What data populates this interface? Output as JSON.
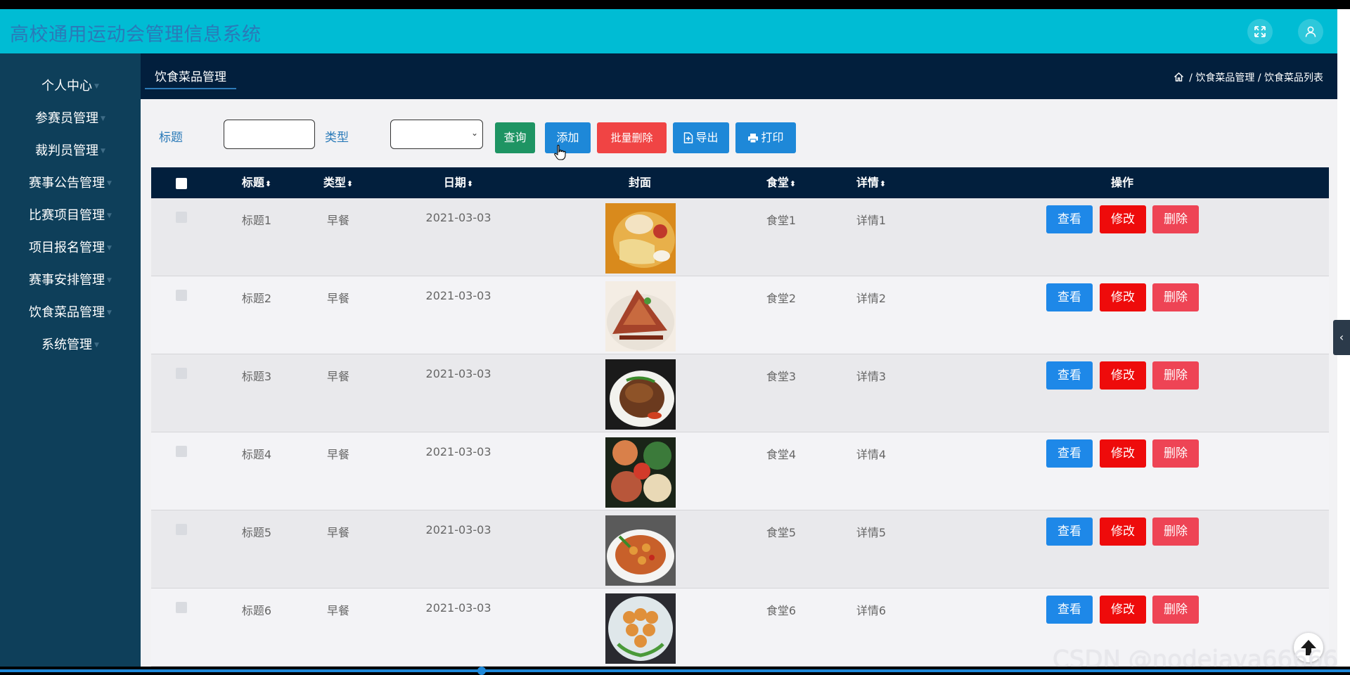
{
  "app": {
    "title": "高校通用运动会管理信息系统"
  },
  "sidebar": {
    "items": [
      {
        "label": "个人中心"
      },
      {
        "label": "参赛员管理"
      },
      {
        "label": "裁判员管理"
      },
      {
        "label": "赛事公告管理"
      },
      {
        "label": "比赛项目管理"
      },
      {
        "label": "项目报名管理"
      },
      {
        "label": "赛事安排管理"
      },
      {
        "label": "饮食菜品管理"
      },
      {
        "label": "系统管理"
      }
    ]
  },
  "page": {
    "tab": "饮食菜品管理",
    "breadcrumb": [
      "饮食菜品管理",
      "饮食菜品列表"
    ],
    "breadcrumb_sep": "/"
  },
  "search": {
    "title_label": "标题",
    "title_value": "",
    "type_label": "类型",
    "type_value": ""
  },
  "buttons": {
    "query": "查询",
    "add": "添加",
    "batch_delete": "批量删除",
    "export": "导出",
    "print": "打印"
  },
  "table": {
    "headers": {
      "title": "标题",
      "type": "类型",
      "date": "日期",
      "cover": "封面",
      "canteen": "食堂",
      "detail": "详情",
      "actions": "操作"
    },
    "action_labels": {
      "view": "查看",
      "edit": "修改",
      "delete": "删除"
    },
    "rows": [
      {
        "title": "标题1",
        "type": "早餐",
        "date": "2021-03-03",
        "canteen": "食堂1",
        "detail": "详情1"
      },
      {
        "title": "标题2",
        "type": "早餐",
        "date": "2021-03-03",
        "canteen": "食堂2",
        "detail": "详情2"
      },
      {
        "title": "标题3",
        "type": "早餐",
        "date": "2021-03-03",
        "canteen": "食堂3",
        "detail": "详情3"
      },
      {
        "title": "标题4",
        "type": "早餐",
        "date": "2021-03-03",
        "canteen": "食堂4",
        "detail": "详情4"
      },
      {
        "title": "标题5",
        "type": "早餐",
        "date": "2021-03-03",
        "canteen": "食堂5",
        "detail": "详情5"
      },
      {
        "title": "标题6",
        "type": "早餐",
        "date": "2021-03-03",
        "canteen": "食堂6",
        "detail": "详情6"
      }
    ]
  },
  "watermark": "CSDN @nodejava666666",
  "colors": {
    "topbar": "#00bcd4",
    "sidebar": "#0e3f5a",
    "header_dark": "#021f3d",
    "query_btn": "#1e9463",
    "blue_btn": "#1e88d8",
    "red_btn": "#f04444",
    "edit_btn": "#ee0b0b",
    "delete_btn": "#ee4455"
  },
  "icons": {
    "fullscreen": "expand-icon",
    "user": "user-icon",
    "home": "home-icon",
    "export": "export-icon",
    "print": "print-icon",
    "sort": "sort-icon",
    "collapse": "chevron-left-icon",
    "back_to_top": "arrow-up-icon"
  }
}
